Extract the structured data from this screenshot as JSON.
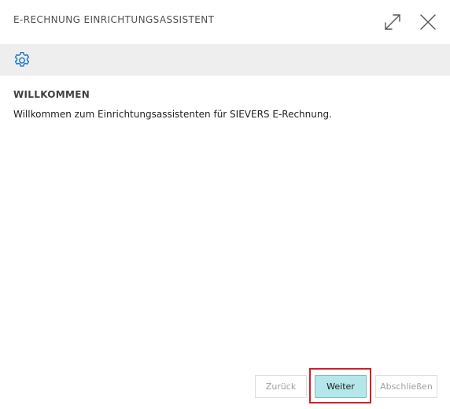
{
  "dialog": {
    "title": "E-RECHNUNG EINRICHTUNGSASSISTENT"
  },
  "actionbar": {
    "icon": "gear-icon"
  },
  "page": {
    "heading": "WILLKOMMEN",
    "text": "Willkommen zum Einrichtungsassistenten für SIEVERS E-Rechnung."
  },
  "buttons": {
    "back_label": "Zurück",
    "next_label": "Weiter",
    "finish_label": "Abschließen"
  },
  "colors": {
    "next_button": "#b4e6ea",
    "highlight": "#d42026",
    "actionbar": "#eeeeee",
    "icon_accent": "#1a73c9"
  }
}
